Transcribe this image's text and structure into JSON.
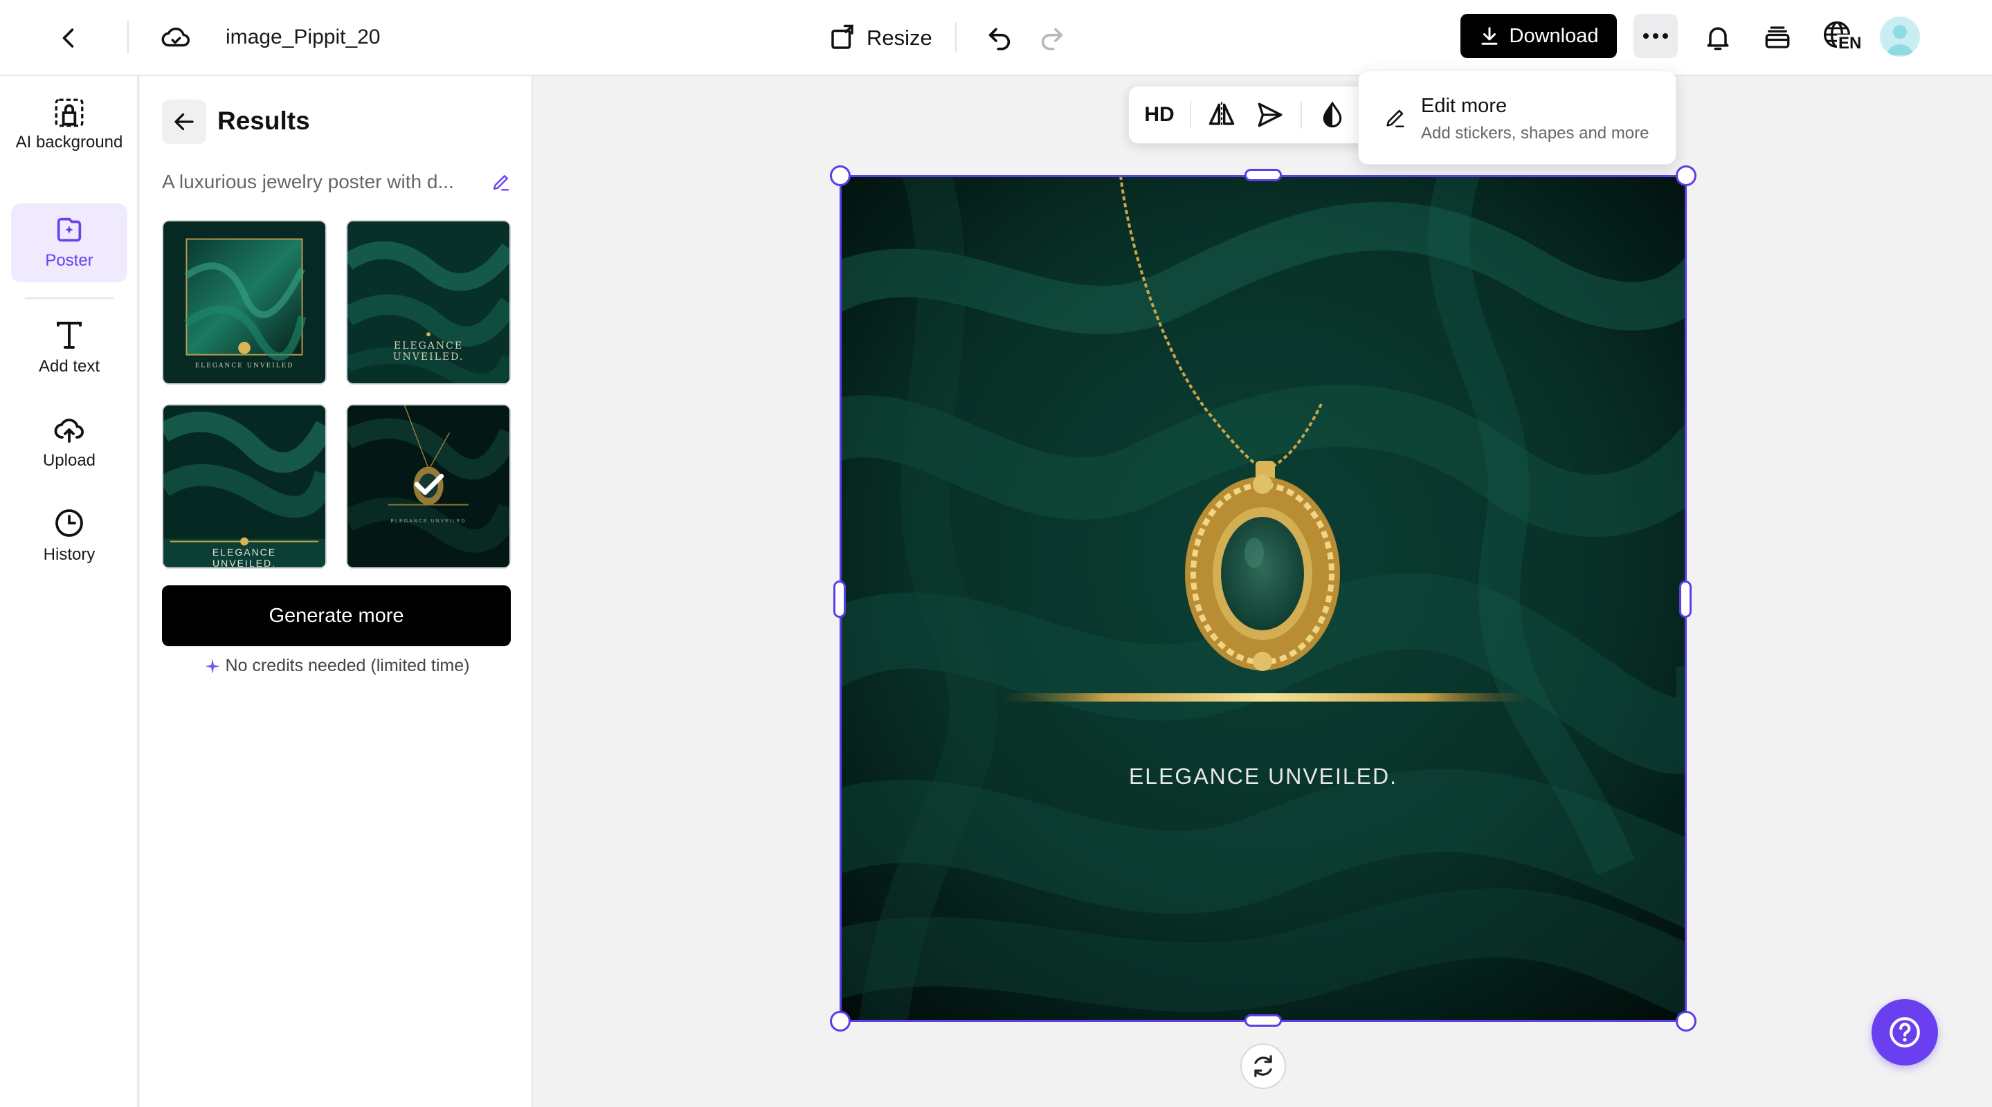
{
  "app": {
    "file_name": "image_Pippit_20",
    "accent_color": "#6a3ff0"
  },
  "topbar": {
    "back_icon": "chevron-left-icon",
    "cloud_icon": "cloud-sync-icon",
    "resize_label": "Resize",
    "undo_icon": "undo-icon",
    "redo_icon": "redo-icon",
    "download_label": "Download",
    "more_icon": "ellipsis-icon",
    "bell_icon": "bell-icon",
    "stack_icon": "layers-icon",
    "language_code": "EN"
  },
  "rail": {
    "items": [
      {
        "label": "AI background",
        "icon": "ai-background-icon",
        "active": false
      },
      {
        "label": "Poster",
        "icon": "poster-icon",
        "active": true
      },
      {
        "label": "Add text",
        "icon": "text-icon",
        "active": false
      },
      {
        "label": "Upload",
        "icon": "upload-cloud-icon",
        "active": false
      },
      {
        "label": "History",
        "icon": "history-clock-icon",
        "active": false
      }
    ]
  },
  "panel": {
    "title": "Results",
    "prompt_text": "A luxurious jewelry poster with d...",
    "thumbnails": [
      {
        "caption": "ELEGANCE UNVEILED",
        "selected": false
      },
      {
        "caption": "ELEGANCE UNVEILED.",
        "selected": false
      },
      {
        "caption": "ELEGANCE UNVEILED.",
        "selected": false
      },
      {
        "caption": "ELEGANCE UNVEILED",
        "selected": true
      }
    ],
    "generate_label": "Generate more",
    "credits_note": "No credits needed (limited time)"
  },
  "float_toolbar": {
    "hd_label": "HD",
    "flip_icon": "flip-horizontal-icon",
    "send_icon": "send-icon",
    "drop_icon": "opacity-drop-icon"
  },
  "edit_more": {
    "title": "Edit more",
    "subtitle": "Add stickers, shapes and more"
  },
  "poster": {
    "caption": "ELEGANCE UNVEILED."
  },
  "help_icon": "question-icon"
}
